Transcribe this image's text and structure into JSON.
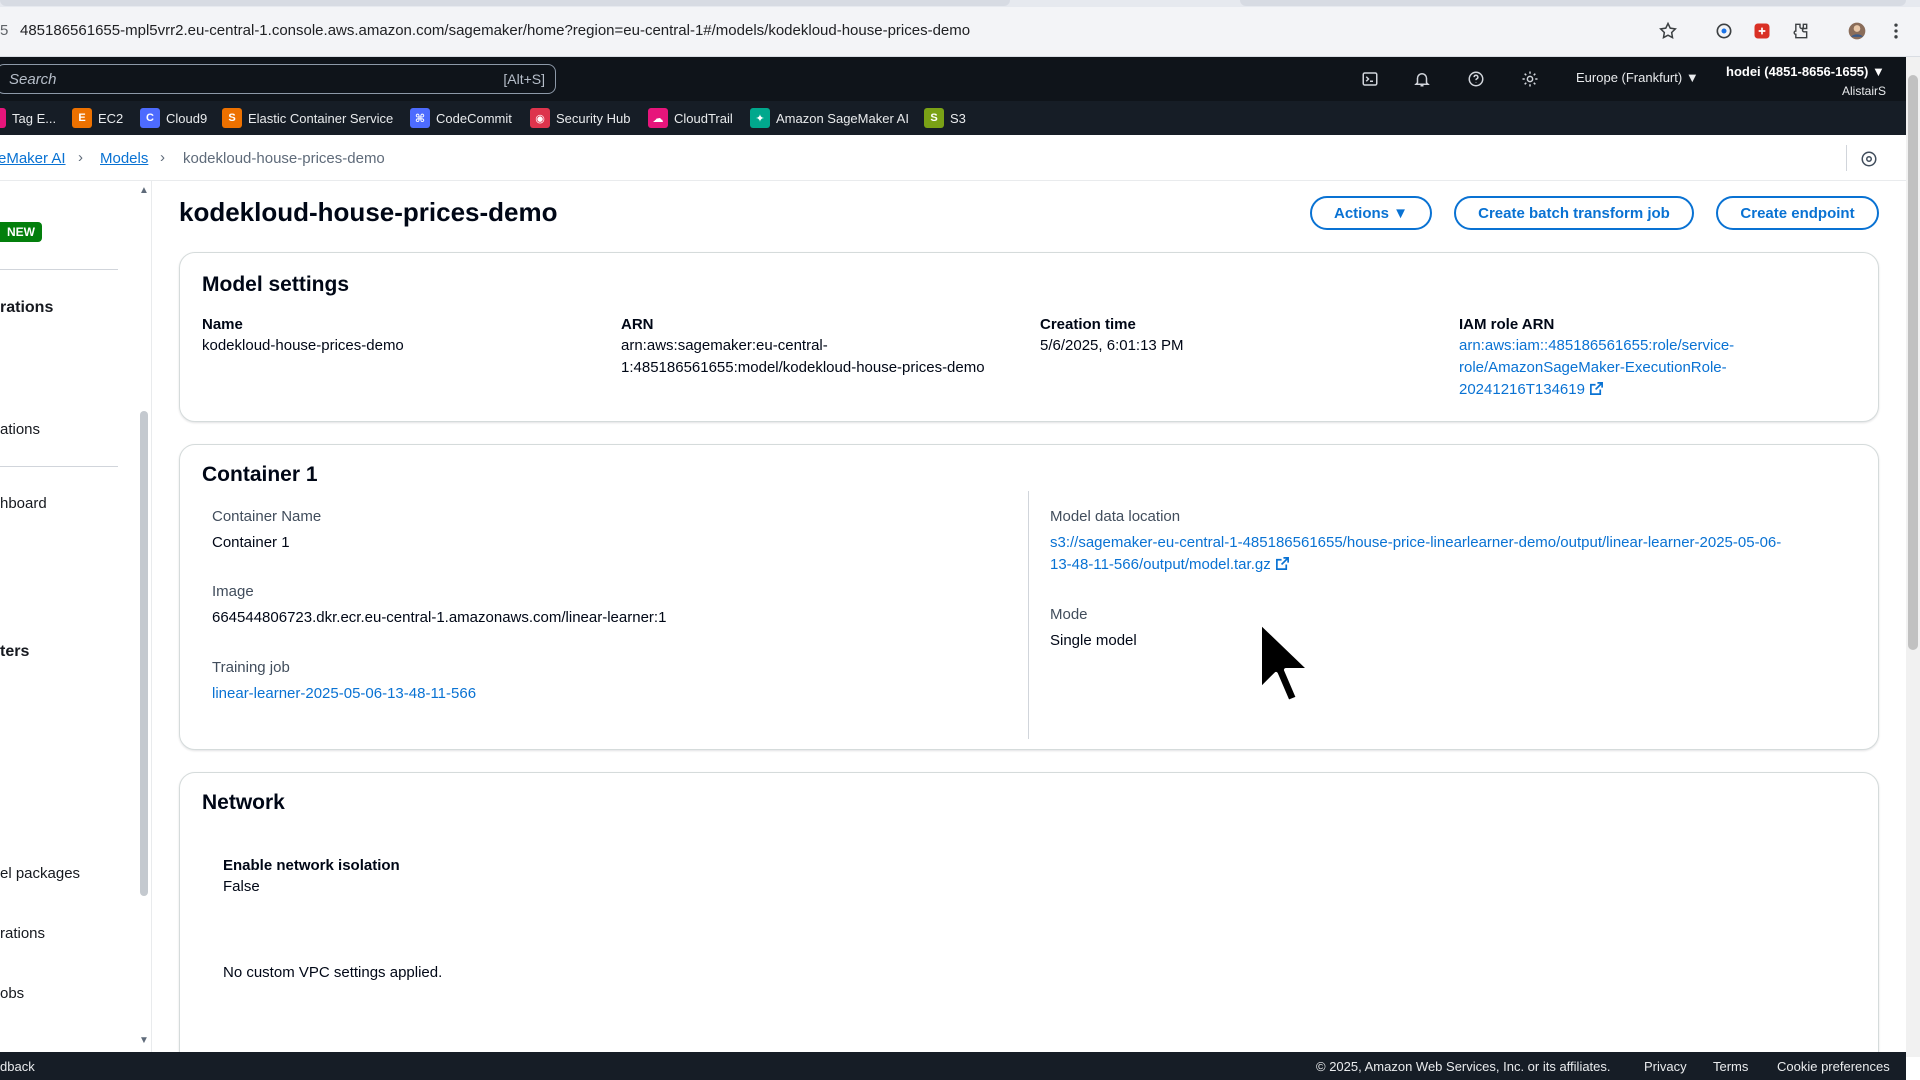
{
  "browser": {
    "url": "485186561655-mpl5vrr2.eu-central-1.console.aws.amazon.com/sagemaker/home?region=eu-central-1#/models/kodekloud-house-prices-demo",
    "url_left_fragment": "5"
  },
  "aws_nav": {
    "search_placeholder": "Search",
    "search_shortcut": "[Alt+S]",
    "region": "Europe (Frankfurt) ▼",
    "account": "hodei (4851-8656-1655) ▼",
    "account_sub": "AlistairS"
  },
  "favorites": [
    {
      "label": "Tag E...",
      "color": "#e7157b",
      "glyph": "T"
    },
    {
      "label": "EC2",
      "color": "#ed7100",
      "glyph": "E"
    },
    {
      "label": "Cloud9",
      "color": "#4d6bfe",
      "glyph": "C"
    },
    {
      "label": "Elastic Container Service",
      "color": "#ed7100",
      "glyph": "S"
    },
    {
      "label": "CodeCommit",
      "color": "#4d6bfe",
      "glyph": "⌘"
    },
    {
      "label": "Security Hub",
      "color": "#dd344c",
      "glyph": "◉"
    },
    {
      "label": "CloudTrail",
      "color": "#e7157b",
      "glyph": "☁"
    },
    {
      "label": "Amazon SageMaker AI",
      "color": "#01a88d",
      "glyph": "✦"
    },
    {
      "label": "S3",
      "color": "#7aa116",
      "glyph": "S"
    }
  ],
  "breadcrumb": {
    "root": "eMaker AI",
    "models": "Models",
    "current": "kodekloud-house-prices-demo"
  },
  "sidebar": {
    "badge": "NEW",
    "items": [
      "rations",
      "ations",
      "hboard",
      "ters",
      "el packages",
      "rations",
      "obs"
    ]
  },
  "page": {
    "title": "kodekloud-house-prices-demo",
    "actions_label": "Actions ▼",
    "batch_label": "Create batch transform job",
    "endpoint_label": "Create endpoint"
  },
  "model_settings": {
    "title": "Model settings",
    "name_label": "Name",
    "name_value": "kodekloud-house-prices-demo",
    "arn_label": "ARN",
    "arn_value_1": "arn:aws:sagemaker:eu-central-",
    "arn_value_2": "1:485186561655:model/kodekloud-house-prices-demo",
    "creation_label": "Creation time",
    "creation_value": "5/6/2025, 6:01:13 PM",
    "iam_label": "IAM role ARN",
    "iam_value_1": "arn:aws:iam::485186561655:role/service-",
    "iam_value_2": "role/AmazonSageMaker-ExecutionRole-",
    "iam_value_3": "20241216T134619"
  },
  "container": {
    "title": "Container 1",
    "name_label": "Container Name",
    "name_value": "Container 1",
    "image_label": "Image",
    "image_value": "664544806723.dkr.ecr.eu-central-1.amazonaws.com/linear-learner:1",
    "training_label": "Training job",
    "training_value": "linear-learner-2025-05-06-13-48-11-566",
    "data_label": "Model data location",
    "data_value_1": "s3://sagemaker-eu-central-1-485186561655/house-price-linearlearner-demo/output/linear-learner-2025-05-06-",
    "data_value_2": "13-48-11-566/output/model.tar.gz",
    "mode_label": "Mode",
    "mode_value": "Single model"
  },
  "network": {
    "title": "Network",
    "isolation_label": "Enable network isolation",
    "isolation_value": "False",
    "vpc_text": "No custom VPC settings applied."
  },
  "footer": {
    "feedback": "dback",
    "copyright": "© 2025, Amazon Web Services, Inc. or its affiliates.",
    "privacy": "Privacy",
    "terms": "Terms",
    "cookies": "Cookie preferences"
  },
  "colors": {
    "link": "#0972d3",
    "nav_bg": "#0f141a",
    "badge_green": "#037f0c"
  }
}
